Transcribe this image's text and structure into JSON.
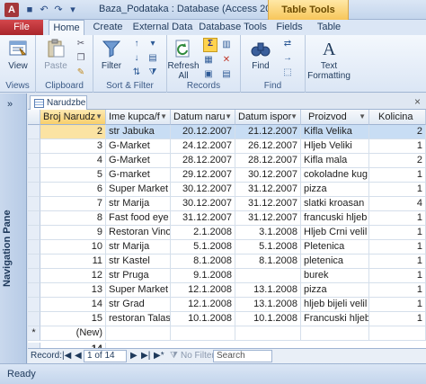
{
  "window": {
    "title": "Baza_Podataka : Database (Access 2007 - 2...",
    "contextual_tab": "Table Tools"
  },
  "ribbon_tabs": [
    "File",
    "Home",
    "Create",
    "External Data",
    "Database Tools",
    "Fields",
    "Table"
  ],
  "ribbon": {
    "views": {
      "view_label": "View",
      "group": "Views"
    },
    "clipboard": {
      "paste_label": "Paste",
      "group": "Clipboard"
    },
    "sort_filter": {
      "filter_label": "Filter",
      "group": "Sort & Filter"
    },
    "records": {
      "refresh_label": "Refresh All",
      "group": "Records"
    },
    "find": {
      "find_label": "Find",
      "group": "Find"
    },
    "text_formatting": {
      "label": "Text Formatting",
      "group": ""
    }
  },
  "nav_pane": {
    "toggle": "»",
    "label": "Navigation Pane"
  },
  "doc_tab": {
    "name": "Narudzbe"
  },
  "table": {
    "columns": [
      "Broj Narudz",
      "Ime kupca/f",
      "Datum naru",
      "Datum ispor",
      "Proizvod",
      "Kolicina"
    ],
    "rows": [
      [
        "2",
        "str Jabuka",
        "20.12.2007",
        "21.12.2007",
        "Kifla Velika",
        "2"
      ],
      [
        "3",
        "G-Market",
        "24.12.2007",
        "26.12.2007",
        "Hljeb Veliki",
        "1"
      ],
      [
        "4",
        "G-Market",
        "28.12.2007",
        "28.12.2007",
        "Kifla mala",
        "2"
      ],
      [
        "5",
        "G-market",
        "29.12.2007",
        "30.12.2007",
        "cokoladne kug",
        "1"
      ],
      [
        "6",
        "Super Market",
        "30.12.2007",
        "31.12.2007",
        "pizza",
        "1"
      ],
      [
        "7",
        "str Marija",
        "30.12.2007",
        "31.12.2007",
        "slatki kroasan",
        "4"
      ],
      [
        "8",
        "Fast food eye",
        "31.12.2007",
        "31.12.2007",
        "francuski hljeb",
        "1"
      ],
      [
        "9",
        "Restoran Vino",
        "2.1.2008",
        "3.1.2008",
        "Hljeb Crni velil",
        "1"
      ],
      [
        "10",
        "str Marija",
        "5.1.2008",
        "5.1.2008",
        "Pletenica",
        "1"
      ],
      [
        "11",
        "str Kastel",
        "8.1.2008",
        "8.1.2008",
        "pletenica",
        "1"
      ],
      [
        "12",
        "str Pruga",
        "9.1.2008",
        "",
        "burek",
        "1"
      ],
      [
        "13",
        "Super Market",
        "12.1.2008",
        "13.1.2008",
        "pizza",
        "1"
      ],
      [
        "14",
        "str Grad",
        "12.1.2008",
        "13.1.2008",
        "hljeb bijeli velil",
        "1"
      ],
      [
        "15",
        "restoran Talas",
        "10.1.2008",
        "10.1.2008",
        "Francuski hljeb",
        "1"
      ]
    ],
    "new_row_label": "(New)",
    "new_row_marker": "*",
    "total_value": "14"
  },
  "record_nav": {
    "label": "Record:",
    "position": "1 of 14",
    "no_filter": "No Filter",
    "search": "Search"
  },
  "status": {
    "text": "Ready"
  }
}
